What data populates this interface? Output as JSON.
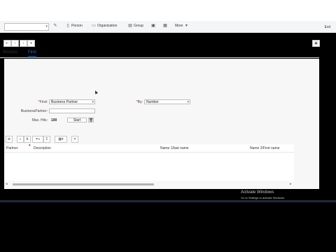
{
  "header": {
    "exit_label": "Exit"
  },
  "toolbar": {
    "command_placeholder": "",
    "items": [
      {
        "label": "Person",
        "icon": "person-icon"
      },
      {
        "label": "Organization",
        "icon": "organization-icon"
      },
      {
        "label": "Group",
        "icon": "group-icon"
      },
      {
        "label": "More",
        "icon": "chevron-down-icon"
      }
    ]
  },
  "tabs": [
    {
      "label": "Worklist",
      "active": false
    },
    {
      "label": "Find",
      "active": true
    }
  ],
  "search": {
    "find_label": "Find:",
    "find_value": "Business Partner",
    "by_label": "By:",
    "by_value": "Number",
    "bp_label": "BusinessPartner:",
    "bp_value": "",
    "maxhits_label": "Max. Hits:",
    "maxhits_value": "100",
    "start_label": "Start"
  },
  "grid": {
    "columns": [
      "Partner",
      "Description",
      "Name 1/last name",
      "Name 2/First name"
    ]
  },
  "watermark": {
    "line1": "Activate Windows",
    "line2": "Go to Settings to activate Windows."
  }
}
